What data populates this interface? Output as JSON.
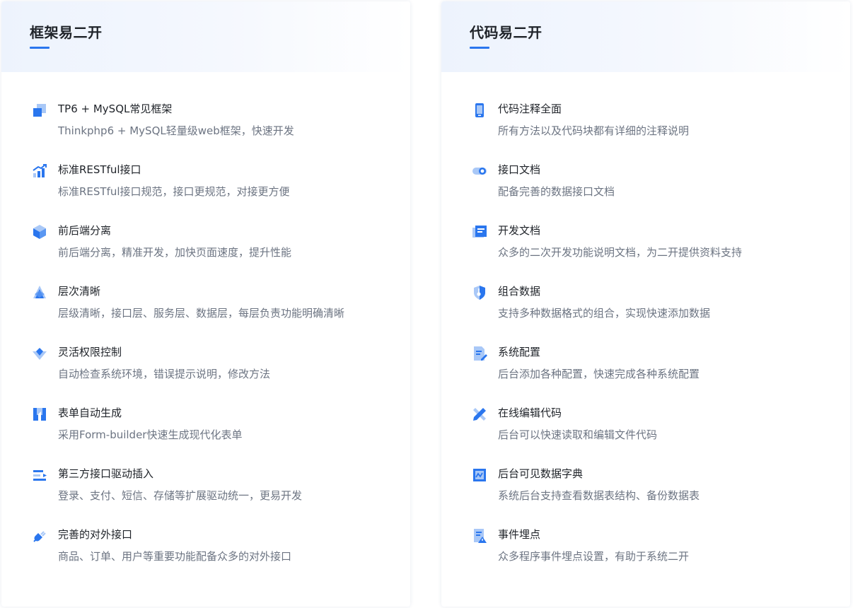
{
  "colors": {
    "accent": "#2a76ee",
    "icon_light": "#a9c8f7",
    "title_text": "#1f2329",
    "desc_text": "#6c7482"
  },
  "left": {
    "title": "框架易二开",
    "features": [
      {
        "icon": "cube-layers-icon",
        "title": "TP6 + MySQL常见框架",
        "desc": "Thinkphp6 + MySQL轻量级web框架，快速开发"
      },
      {
        "icon": "growth-chart-icon",
        "title": "标准RESTful接口",
        "desc": "标准RESTful接口规范，接口更规范，对接更方便"
      },
      {
        "icon": "hex-box-icon",
        "title": "前后端分离",
        "desc": "前后端分离，精准开发，加快页面速度，提升性能"
      },
      {
        "icon": "layer-stack-icon",
        "title": "层次清晰",
        "desc": "层级清晰，接口层、服务层、数据层，每层负责功能明确清晰"
      },
      {
        "icon": "permission-diamond-icon",
        "title": "灵活权限控制",
        "desc": "自动检查系统环境，错误提示说明，修改方法"
      },
      {
        "icon": "form-builder-icon",
        "title": "表单自动生成",
        "desc": "采用Form-builder快速生成现代化表单"
      },
      {
        "icon": "plugin-driver-icon",
        "title": "第三方接口驱动插入",
        "desc": "登录、支付、短信、存储等扩展驱动统一，更易开发"
      },
      {
        "icon": "connector-plug-icon",
        "title": "完善的对外接口",
        "desc": "商品、订单、用户等重要功能配备众多的对外接口"
      }
    ]
  },
  "right": {
    "title": "代码易二开",
    "features": [
      {
        "icon": "mobile-phone-icon",
        "title": "代码注释全面",
        "desc": "所有方法以及代码块都有详细的注释说明"
      },
      {
        "icon": "toggle-link-icon",
        "title": "接口文档",
        "desc": "配备完善的数据接口文档"
      },
      {
        "icon": "monitor-doc-icon",
        "title": "开发文档",
        "desc": "众多的二次开发功能说明文档，为二开提供资料支持"
      },
      {
        "icon": "shield-key-icon",
        "title": "组合数据",
        "desc": "支持多种数据格式的组合，实现快速添加数据"
      },
      {
        "icon": "doc-edit-icon",
        "title": "系统配置",
        "desc": "后台添加各种配置，快速完成各种系统配置"
      },
      {
        "icon": "pencil-ruler-icon",
        "title": "在线编辑代码",
        "desc": "后台可以快速读取和编辑文件代码"
      },
      {
        "icon": "data-dictionary-icon",
        "title": "后台可见数据字典",
        "desc": "系统后台支持查看数据表结构、备份数据表"
      },
      {
        "icon": "event-alert-icon",
        "title": "事件埋点",
        "desc": "众多程序事件埋点设置，有助于系统二开"
      }
    ]
  }
}
